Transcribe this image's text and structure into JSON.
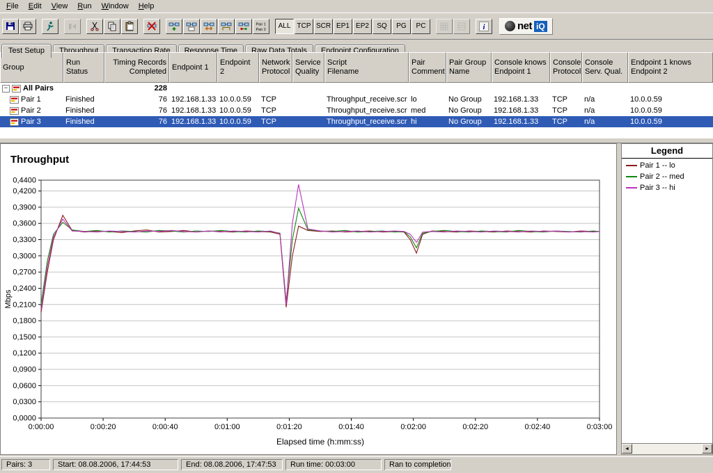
{
  "menu": {
    "items": [
      "File",
      "Edit",
      "View",
      "Run",
      "Window",
      "Help"
    ]
  },
  "toolbar": {
    "buttons": [
      {
        "icon": "save"
      },
      {
        "icon": "print"
      },
      {
        "icon": "run-test",
        "gap": true
      },
      {
        "icon": "stop-run",
        "disabled": true,
        "gap": true
      },
      {
        "icon": "cut",
        "gap": true
      },
      {
        "icon": "copy"
      },
      {
        "icon": "paste"
      },
      {
        "icon": "delete-pair",
        "gap": true
      },
      {
        "icon": "add-pair",
        "gap": true
      },
      {
        "icon": "copy-pair"
      },
      {
        "icon": "swap-endpoints"
      },
      {
        "icon": "group-pairs"
      },
      {
        "icon": "connect-pairs"
      },
      {
        "icon": "pair1-pair2"
      }
    ],
    "filters": [
      "ALL",
      "TCP",
      "SCR",
      "EP1",
      "EP2",
      "SQ",
      "PG",
      "PC"
    ],
    "filter_active": "ALL",
    "trailing": [
      {
        "icon": "view-grid",
        "disabled": true,
        "gap": true
      },
      {
        "icon": "view-list",
        "disabled": true
      },
      {
        "icon": "info",
        "gap": true
      }
    ],
    "logo": {
      "net": "net",
      "iq": "iQ"
    }
  },
  "tabs": {
    "items": [
      "Test Setup",
      "Throughput",
      "Transaction Rate",
      "Response Time",
      "Raw Data Totals",
      "Endpoint Configuration"
    ],
    "active": 0
  },
  "table": {
    "columns": [
      [
        "Group"
      ],
      [
        "Run Status"
      ],
      [
        "Timing Records",
        "Completed"
      ],
      [
        "Endpoint 1"
      ],
      [
        "Endpoint 2"
      ],
      [
        "Network",
        "Protocol"
      ],
      [
        "Service",
        "Quality"
      ],
      [
        "Script",
        "Filename"
      ],
      [
        "Pair",
        "Comment"
      ],
      [
        "Pair Group",
        "Name"
      ],
      [
        "Console knows",
        "Endpoint 1"
      ],
      [
        "Console",
        "Protocol"
      ],
      [
        "Console",
        "Serv. Qual."
      ],
      [
        "Endpoint 1 knows",
        "Endpoint 2"
      ]
    ],
    "group_row": {
      "name": "All Pairs",
      "timing_records": "228"
    },
    "rows": [
      {
        "name": "Pair 1",
        "run_status": "Finished",
        "timing_records": "76",
        "endpoint1": "192.168.1.33",
        "endpoint2": "10.0.0.59",
        "network_protocol": "TCP",
        "service_quality": "",
        "script_filename": "Throughput_receive.scr",
        "pair_comment": "lo",
        "pair_group_name": "No Group",
        "console_knows_endpoint1": "192.168.1.33",
        "console_protocol": "TCP",
        "console_serv_qual": "n/a",
        "endpoint1_knows_endpoint2": "10.0.0.59",
        "selected": false
      },
      {
        "name": "Pair 2",
        "run_status": "Finished",
        "timing_records": "76",
        "endpoint1": "192.168.1.33",
        "endpoint2": "10.0.0.59",
        "network_protocol": "TCP",
        "service_quality": "",
        "script_filename": "Throughput_receive.scr",
        "pair_comment": "med",
        "pair_group_name": "No Group",
        "console_knows_endpoint1": "192.168.1.33",
        "console_protocol": "TCP",
        "console_serv_qual": "n/a",
        "endpoint1_knows_endpoint2": "10.0.0.59",
        "selected": false
      },
      {
        "name": "Pair 3",
        "run_status": "Finished",
        "timing_records": "76",
        "endpoint1": "192.168.1.33",
        "endpoint2": "10.0.0.59",
        "network_protocol": "TCP",
        "service_quality": "",
        "script_filename": "Throughput_receive.scr",
        "pair_comment": "hi",
        "pair_group_name": "No Group",
        "console_knows_endpoint1": "192.168.1.33",
        "console_protocol": "TCP",
        "console_serv_qual": "n/a",
        "endpoint1_knows_endpoint2": "10.0.0.59",
        "selected": true
      }
    ]
  },
  "chart_data": {
    "type": "line",
    "title": "Throughput",
    "xlabel": "Elapsed time (h:mm:ss)",
    "ylabel": "Mbps",
    "legend_title": "Legend",
    "legend_position": "right",
    "xlim": [
      0,
      180
    ],
    "ylim": [
      0,
      0.44
    ],
    "grid": "horizontal",
    "y_ticks": [
      {
        "value": 0.44,
        "label": "0,4400"
      },
      {
        "value": 0.42,
        "label": "0,4200"
      },
      {
        "value": 0.39,
        "label": "0,3900"
      },
      {
        "value": 0.36,
        "label": "0,3600"
      },
      {
        "value": 0.33,
        "label": "0,3300"
      },
      {
        "value": 0.3,
        "label": "0,3000"
      },
      {
        "value": 0.27,
        "label": "0,2700"
      },
      {
        "value": 0.24,
        "label": "0,2400"
      },
      {
        "value": 0.21,
        "label": "0,2100"
      },
      {
        "value": 0.18,
        "label": "0,1800"
      },
      {
        "value": 0.15,
        "label": "0,1500"
      },
      {
        "value": 0.12,
        "label": "0,1200"
      },
      {
        "value": 0.09,
        "label": "0,0900"
      },
      {
        "value": 0.06,
        "label": "0,0600"
      },
      {
        "value": 0.03,
        "label": "0,0300"
      },
      {
        "value": 0.0,
        "label": "0,0000"
      }
    ],
    "x_ticks": [
      {
        "value": 0,
        "label": "0:00:00"
      },
      {
        "value": 20,
        "label": "0:00:20"
      },
      {
        "value": 40,
        "label": "0:00:40"
      },
      {
        "value": 60,
        "label": "0:01:00"
      },
      {
        "value": 80,
        "label": "0:01:20"
      },
      {
        "value": 100,
        "label": "0:01:40"
      },
      {
        "value": 120,
        "label": "0:02:00"
      },
      {
        "value": 140,
        "label": "0:02:20"
      },
      {
        "value": 160,
        "label": "0:02:40"
      },
      {
        "value": 180,
        "label": "0:03:00"
      }
    ],
    "x": [
      0,
      2,
      4,
      7,
      10,
      14,
      18,
      22,
      26,
      30,
      34,
      38,
      42,
      46,
      50,
      54,
      58,
      62,
      66,
      70,
      74,
      77,
      79,
      81,
      83,
      86,
      90,
      94,
      98,
      102,
      106,
      110,
      114,
      117,
      119,
      121,
      123,
      126,
      130,
      134,
      138,
      142,
      146,
      150,
      154,
      158,
      162,
      166,
      170,
      174,
      178,
      180
    ],
    "series": [
      {
        "name": "Pair 1 -- lo",
        "color": "#8b1a1a",
        "values": [
          0.195,
          0.27,
          0.33,
          0.375,
          0.347,
          0.344,
          0.346,
          0.345,
          0.343,
          0.346,
          0.348,
          0.344,
          0.345,
          0.347,
          0.344,
          0.346,
          0.345,
          0.344,
          0.346,
          0.345,
          0.344,
          0.34,
          0.205,
          0.3,
          0.355,
          0.347,
          0.345,
          0.346,
          0.344,
          0.345,
          0.346,
          0.344,
          0.345,
          0.344,
          0.33,
          0.305,
          0.34,
          0.346,
          0.345,
          0.344,
          0.346,
          0.345,
          0.344,
          0.346,
          0.345,
          0.344,
          0.346,
          0.345,
          0.344,
          0.346,
          0.345,
          0.345
        ]
      },
      {
        "name": "Pair 2 -- med",
        "color": "#118811",
        "values": [
          0.21,
          0.29,
          0.34,
          0.362,
          0.348,
          0.345,
          0.347,
          0.344,
          0.346,
          0.345,
          0.344,
          0.347,
          0.346,
          0.344,
          0.346,
          0.345,
          0.347,
          0.345,
          0.344,
          0.346,
          0.345,
          0.342,
          0.215,
          0.33,
          0.388,
          0.348,
          0.346,
          0.345,
          0.347,
          0.344,
          0.345,
          0.346,
          0.344,
          0.345,
          0.335,
          0.315,
          0.342,
          0.345,
          0.347,
          0.345,
          0.344,
          0.346,
          0.345,
          0.344,
          0.347,
          0.345,
          0.344,
          0.346,
          0.345,
          0.344,
          0.346,
          0.345
        ]
      },
      {
        "name": "Pair 3 -- hi",
        "color": "#bb33bb",
        "values": [
          0.2,
          0.28,
          0.335,
          0.368,
          0.346,
          0.345,
          0.344,
          0.346,
          0.345,
          0.344,
          0.346,
          0.345,
          0.347,
          0.345,
          0.344,
          0.346,
          0.344,
          0.346,
          0.345,
          0.344,
          0.346,
          0.341,
          0.21,
          0.36,
          0.432,
          0.35,
          0.346,
          0.344,
          0.345,
          0.346,
          0.344,
          0.345,
          0.346,
          0.345,
          0.34,
          0.325,
          0.344,
          0.345,
          0.344,
          0.346,
          0.345,
          0.344,
          0.346,
          0.345,
          0.344,
          0.346,
          0.345,
          0.346,
          0.344,
          0.345,
          0.344,
          0.345
        ]
      }
    ]
  },
  "statusbar": {
    "pairs": "Pairs: 3",
    "start": "Start: 08.08.2006, 17:44:53",
    "end": "End: 08.08.2006, 17:47:53",
    "runtime": "Run time: 00:03:00",
    "result": "Ran to completion"
  }
}
